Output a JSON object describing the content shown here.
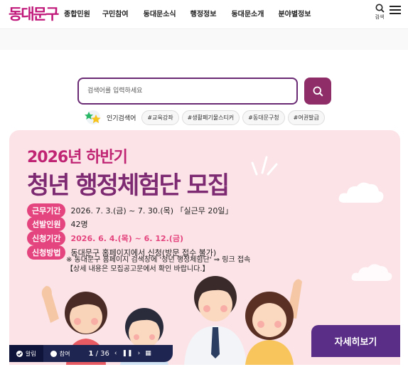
{
  "header": {
    "logo": "동대문구",
    "nav": [
      "종합민원",
      "구민참여",
      "동대문소식",
      "행정정보",
      "동대문소개",
      "분야별정보"
    ],
    "search_label": "검색"
  },
  "search": {
    "placeholder": "검색어를 입력하세요"
  },
  "popular": {
    "label": "인기검색어",
    "tags": [
      "#교육강좌",
      "#생활폐기물스티커",
      "#동대문구청",
      "#여권발급"
    ]
  },
  "banner": {
    "year": "2026년 하반기",
    "title": "청년 행정체험단 모집",
    "rows": [
      {
        "label": "근무기간",
        "value": "2026. 7. 3.(금) ~ 7. 30.(목) 「실근무 20일」"
      },
      {
        "label": "선발인원",
        "value": "42명"
      },
      {
        "label": "신청기간",
        "value": "2026. 6. 4.(목) ~ 6. 12.(금)"
      },
      {
        "label": "신청방법",
        "value": "동대문구 홈페이지에서 신청(방문 접수 불가)"
      }
    ],
    "note1": "※ 동대문구 홈페이지 검색창에 '청년 행정체험단' ⇒ 링크 접속",
    "note2": "【상세 내용은 모집공고문에서 확인 바랍니다.】",
    "cta": "자세히보기"
  },
  "controls": {
    "tab1": "알림",
    "tab2": "참여",
    "current": "1",
    "total": "/ 36"
  },
  "colors": {
    "brand": "#c0187a",
    "accent": "#8f2d68",
    "banner_bg": "#fbe3e7",
    "pill": "#e5457e",
    "cta": "#5a2e86"
  }
}
